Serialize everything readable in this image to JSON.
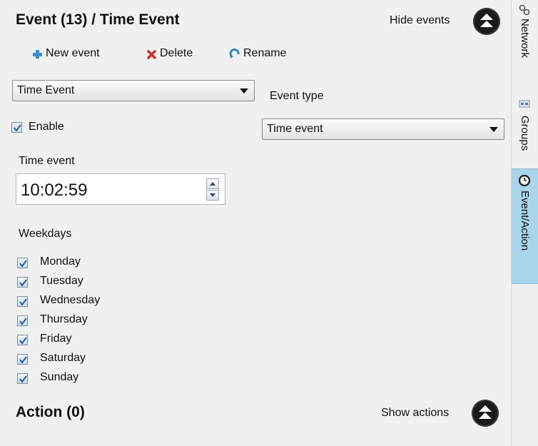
{
  "header": {
    "title": "Event (13) / Time Event",
    "toggle_label": "Hide events"
  },
  "toolbar": {
    "new_label": "New event",
    "delete_label": "Delete",
    "rename_label": "Rename"
  },
  "event_select": {
    "value": "Time Event"
  },
  "event_type": {
    "label": "Event type",
    "value": "Time event"
  },
  "enable": {
    "label": "Enable",
    "checked": true
  },
  "time_event": {
    "label": "Time event",
    "value": "10:02:59"
  },
  "weekdays": {
    "label": "Weekdays",
    "days": [
      {
        "label": "Monday",
        "checked": true
      },
      {
        "label": "Tuesday",
        "checked": true
      },
      {
        "label": "Wednesday",
        "checked": true
      },
      {
        "label": "Thursday",
        "checked": true
      },
      {
        "label": "Friday",
        "checked": true
      },
      {
        "label": "Saturday",
        "checked": true
      },
      {
        "label": "Sunday",
        "checked": true
      }
    ]
  },
  "action": {
    "title": "Action (0)",
    "toggle_label": "Show actions"
  },
  "side_tabs": [
    {
      "label": "Network",
      "icon": "network-icon",
      "active": false
    },
    {
      "label": "Groups",
      "icon": "groups-icon",
      "active": false
    },
    {
      "label": "Event/Action",
      "icon": "clock-icon",
      "active": true
    }
  ],
  "colors": {
    "panel_bg": "#f0f0f0",
    "active_tab_bg": "#a9d4ea",
    "new_icon": "#3a8fd0",
    "delete_icon": "#d03030",
    "rename_icon": "#2a88c8",
    "checkbox_check": "#1f5fa8",
    "round_button": "#1a1a1a"
  }
}
